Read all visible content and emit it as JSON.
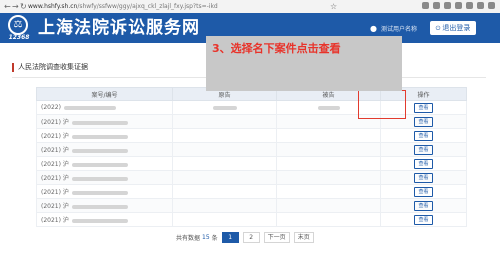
{
  "browser": {
    "host": "www.hshfy.sh.cn",
    "path": "/shwfy/ssfww/ggy/ajxq_ckl_zlajl_fxy.jsp?ts=-ikd"
  },
  "header": {
    "logo_number": "12368",
    "site_title": "上海法院诉讼服务网",
    "user_name": "测试用户名称",
    "logout_label": "退出登录"
  },
  "callout": {
    "text": "3、选择名下案件点击查看"
  },
  "section": {
    "title": "人民法院调查收集证据"
  },
  "table": {
    "headers": [
      "案号/编号",
      "原告",
      "被告",
      "操作"
    ],
    "rows": [
      {
        "year": "(2022)",
        "prefix": "",
        "view_label": "查看"
      },
      {
        "year": "(2021)",
        "prefix": "沪",
        "view_label": "查看"
      },
      {
        "year": "(2021)",
        "prefix": "沪",
        "view_label": "查看"
      },
      {
        "year": "(2021)",
        "prefix": "沪",
        "view_label": "查看"
      },
      {
        "year": "(2021)",
        "prefix": "沪",
        "view_label": "查看"
      },
      {
        "year": "(2021)",
        "prefix": "沪",
        "view_label": "查看"
      },
      {
        "year": "(2021)",
        "prefix": "沪",
        "view_label": "查看"
      },
      {
        "year": "(2021)",
        "prefix": "沪",
        "view_label": "查看"
      },
      {
        "year": "(2021)",
        "prefix": "沪",
        "view_label": "查看"
      }
    ]
  },
  "pager": {
    "total_prefix": "共有数据",
    "total_count": "15",
    "total_suffix": "条",
    "pages": [
      "1",
      "2"
    ],
    "next_label": "下一页",
    "last_label": "末页"
  },
  "colors": {
    "brand_blue": "#1e5aa8",
    "annotation_red": "#e8332a"
  }
}
